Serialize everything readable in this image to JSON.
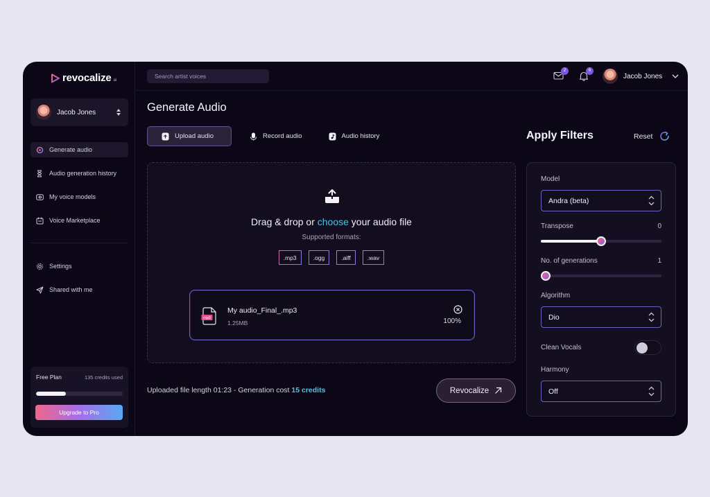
{
  "brand": {
    "name": "revocalize",
    "suffix": "ai"
  },
  "sidebar": {
    "user_name": "Jacob Jones",
    "nav": [
      {
        "label": "Generate audio",
        "icon": "generate-icon"
      },
      {
        "label": "Audio generation history",
        "icon": "hourglass-icon"
      },
      {
        "label": "My voice models",
        "icon": "voice-model-icon"
      },
      {
        "label": "Voice Marketplace",
        "icon": "marketplace-icon"
      }
    ],
    "nav_secondary": [
      {
        "label": "Settings",
        "icon": "gear-icon"
      },
      {
        "label": "Shared with me",
        "icon": "send-icon"
      }
    ],
    "plan": {
      "name": "Free Plan",
      "credits": "135 credits used",
      "usage": 0.34,
      "upgrade_label": "Upgrade to Pro"
    }
  },
  "header": {
    "search_placeholder": "Search artist voices",
    "mail_count": "2",
    "notification_count": "6",
    "user_name": "Jacob Jones"
  },
  "main": {
    "title": "Generate Audio",
    "tabs": [
      {
        "label": "Upload audio",
        "active": true
      },
      {
        "label": "Record audio",
        "active": false
      },
      {
        "label": "Audio history",
        "active": false
      }
    ],
    "dropzone": {
      "title_before": "Drag & drop or ",
      "title_link": "choose",
      "title_after": " your audio file",
      "formats_label": "Supported formats:",
      "formats": [
        ".mp3",
        ".ogg",
        ".aiff",
        ".wav"
      ]
    },
    "file": {
      "name": "My audio_Final_.mp3",
      "size": "1.25MB",
      "progress": "100%",
      "type": "mp3"
    },
    "footer": {
      "text": "Uploaded file length 01:23 - Generation cost ",
      "credits": "15 credits"
    },
    "action_label": "Revocalize"
  },
  "filters": {
    "title": "Apply Filters",
    "reset_label": "Reset",
    "model": {
      "label": "Model",
      "value": "Andra (beta)"
    },
    "transpose": {
      "label": "Transpose",
      "value": "0",
      "position": 0.5
    },
    "generations": {
      "label": "No. of generations",
      "value": "1",
      "position": 0.0
    },
    "algorithm": {
      "label": "Algorithm",
      "value": "Dio"
    },
    "clean_vocals": {
      "label": "Clean Vocals",
      "enabled": false
    },
    "harmony": {
      "label": "Harmony",
      "value": "Off"
    }
  },
  "colors": {
    "accent_cyan": "#4cc3e6",
    "accent_purple": "#7c55e6",
    "accent_pink": "#f0668a",
    "bg": "#0b0716"
  }
}
